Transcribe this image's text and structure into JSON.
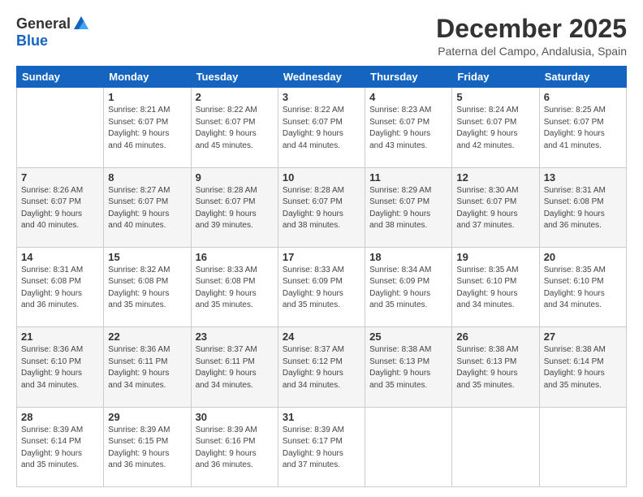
{
  "logo": {
    "general": "General",
    "blue": "Blue"
  },
  "title": {
    "month": "December 2025",
    "location": "Paterna del Campo, Andalusia, Spain"
  },
  "weekdays": [
    "Sunday",
    "Monday",
    "Tuesday",
    "Wednesday",
    "Thursday",
    "Friday",
    "Saturday"
  ],
  "weeks": [
    [
      {
        "day": "",
        "sunrise": "",
        "sunset": "",
        "daylight": ""
      },
      {
        "day": "1",
        "sunrise": "Sunrise: 8:21 AM",
        "sunset": "Sunset: 6:07 PM",
        "daylight": "Daylight: 9 hours and 46 minutes."
      },
      {
        "day": "2",
        "sunrise": "Sunrise: 8:22 AM",
        "sunset": "Sunset: 6:07 PM",
        "daylight": "Daylight: 9 hours and 45 minutes."
      },
      {
        "day": "3",
        "sunrise": "Sunrise: 8:22 AM",
        "sunset": "Sunset: 6:07 PM",
        "daylight": "Daylight: 9 hours and 44 minutes."
      },
      {
        "day": "4",
        "sunrise": "Sunrise: 8:23 AM",
        "sunset": "Sunset: 6:07 PM",
        "daylight": "Daylight: 9 hours and 43 minutes."
      },
      {
        "day": "5",
        "sunrise": "Sunrise: 8:24 AM",
        "sunset": "Sunset: 6:07 PM",
        "daylight": "Daylight: 9 hours and 42 minutes."
      },
      {
        "day": "6",
        "sunrise": "Sunrise: 8:25 AM",
        "sunset": "Sunset: 6:07 PM",
        "daylight": "Daylight: 9 hours and 41 minutes."
      }
    ],
    [
      {
        "day": "7",
        "sunrise": "Sunrise: 8:26 AM",
        "sunset": "Sunset: 6:07 PM",
        "daylight": "Daylight: 9 hours and 40 minutes."
      },
      {
        "day": "8",
        "sunrise": "Sunrise: 8:27 AM",
        "sunset": "Sunset: 6:07 PM",
        "daylight": "Daylight: 9 hours and 40 minutes."
      },
      {
        "day": "9",
        "sunrise": "Sunrise: 8:28 AM",
        "sunset": "Sunset: 6:07 PM",
        "daylight": "Daylight: 9 hours and 39 minutes."
      },
      {
        "day": "10",
        "sunrise": "Sunrise: 8:28 AM",
        "sunset": "Sunset: 6:07 PM",
        "daylight": "Daylight: 9 hours and 38 minutes."
      },
      {
        "day": "11",
        "sunrise": "Sunrise: 8:29 AM",
        "sunset": "Sunset: 6:07 PM",
        "daylight": "Daylight: 9 hours and 38 minutes."
      },
      {
        "day": "12",
        "sunrise": "Sunrise: 8:30 AM",
        "sunset": "Sunset: 6:07 PM",
        "daylight": "Daylight: 9 hours and 37 minutes."
      },
      {
        "day": "13",
        "sunrise": "Sunrise: 8:31 AM",
        "sunset": "Sunset: 6:08 PM",
        "daylight": "Daylight: 9 hours and 36 minutes."
      }
    ],
    [
      {
        "day": "14",
        "sunrise": "Sunrise: 8:31 AM",
        "sunset": "Sunset: 6:08 PM",
        "daylight": "Daylight: 9 hours and 36 minutes."
      },
      {
        "day": "15",
        "sunrise": "Sunrise: 8:32 AM",
        "sunset": "Sunset: 6:08 PM",
        "daylight": "Daylight: 9 hours and 35 minutes."
      },
      {
        "day": "16",
        "sunrise": "Sunrise: 8:33 AM",
        "sunset": "Sunset: 6:08 PM",
        "daylight": "Daylight: 9 hours and 35 minutes."
      },
      {
        "day": "17",
        "sunrise": "Sunrise: 8:33 AM",
        "sunset": "Sunset: 6:09 PM",
        "daylight": "Daylight: 9 hours and 35 minutes."
      },
      {
        "day": "18",
        "sunrise": "Sunrise: 8:34 AM",
        "sunset": "Sunset: 6:09 PM",
        "daylight": "Daylight: 9 hours and 35 minutes."
      },
      {
        "day": "19",
        "sunrise": "Sunrise: 8:35 AM",
        "sunset": "Sunset: 6:10 PM",
        "daylight": "Daylight: 9 hours and 34 minutes."
      },
      {
        "day": "20",
        "sunrise": "Sunrise: 8:35 AM",
        "sunset": "Sunset: 6:10 PM",
        "daylight": "Daylight: 9 hours and 34 minutes."
      }
    ],
    [
      {
        "day": "21",
        "sunrise": "Sunrise: 8:36 AM",
        "sunset": "Sunset: 6:10 PM",
        "daylight": "Daylight: 9 hours and 34 minutes."
      },
      {
        "day": "22",
        "sunrise": "Sunrise: 8:36 AM",
        "sunset": "Sunset: 6:11 PM",
        "daylight": "Daylight: 9 hours and 34 minutes."
      },
      {
        "day": "23",
        "sunrise": "Sunrise: 8:37 AM",
        "sunset": "Sunset: 6:11 PM",
        "daylight": "Daylight: 9 hours and 34 minutes."
      },
      {
        "day": "24",
        "sunrise": "Sunrise: 8:37 AM",
        "sunset": "Sunset: 6:12 PM",
        "daylight": "Daylight: 9 hours and 34 minutes."
      },
      {
        "day": "25",
        "sunrise": "Sunrise: 8:38 AM",
        "sunset": "Sunset: 6:13 PM",
        "daylight": "Daylight: 9 hours and 35 minutes."
      },
      {
        "day": "26",
        "sunrise": "Sunrise: 8:38 AM",
        "sunset": "Sunset: 6:13 PM",
        "daylight": "Daylight: 9 hours and 35 minutes."
      },
      {
        "day": "27",
        "sunrise": "Sunrise: 8:38 AM",
        "sunset": "Sunset: 6:14 PM",
        "daylight": "Daylight: 9 hours and 35 minutes."
      }
    ],
    [
      {
        "day": "28",
        "sunrise": "Sunrise: 8:39 AM",
        "sunset": "Sunset: 6:14 PM",
        "daylight": "Daylight: 9 hours and 35 minutes."
      },
      {
        "day": "29",
        "sunrise": "Sunrise: 8:39 AM",
        "sunset": "Sunset: 6:15 PM",
        "daylight": "Daylight: 9 hours and 36 minutes."
      },
      {
        "day": "30",
        "sunrise": "Sunrise: 8:39 AM",
        "sunset": "Sunset: 6:16 PM",
        "daylight": "Daylight: 9 hours and 36 minutes."
      },
      {
        "day": "31",
        "sunrise": "Sunrise: 8:39 AM",
        "sunset": "Sunset: 6:17 PM",
        "daylight": "Daylight: 9 hours and 37 minutes."
      },
      {
        "day": "",
        "sunrise": "",
        "sunset": "",
        "daylight": ""
      },
      {
        "day": "",
        "sunrise": "",
        "sunset": "",
        "daylight": ""
      },
      {
        "day": "",
        "sunrise": "",
        "sunset": "",
        "daylight": ""
      }
    ]
  ]
}
